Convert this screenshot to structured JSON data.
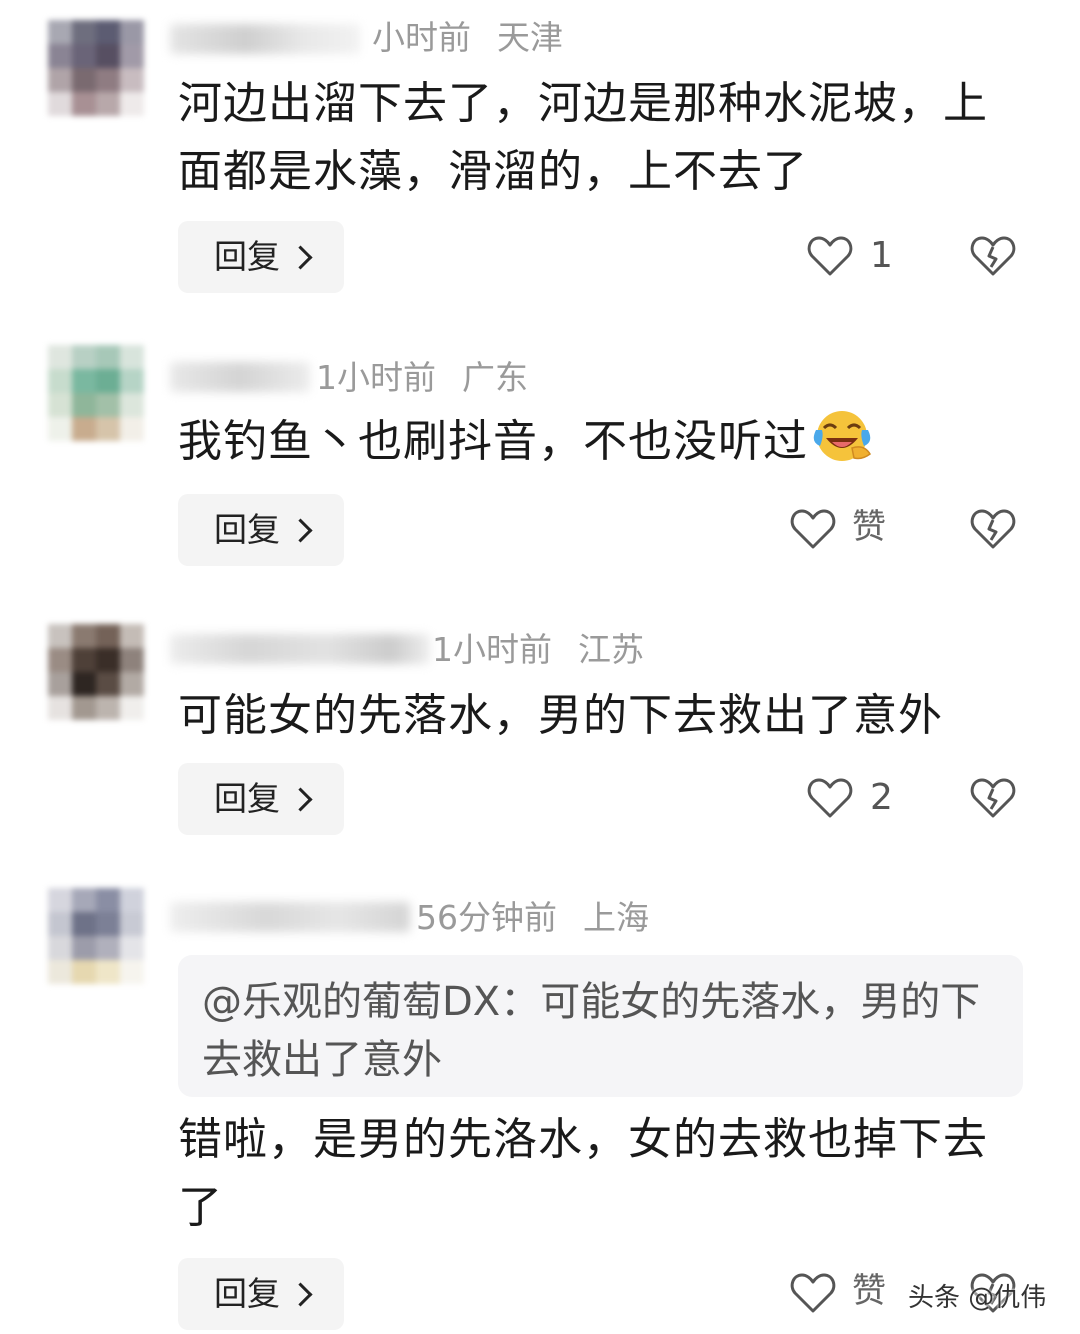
{
  "comments": [
    {
      "time": "小时前",
      "location": "天津",
      "text": "河边出溜下去了，河边是那种水泥坡，上面都是水藻，滑溜的，上不去了",
      "reply_label": "回复",
      "like_count": "1"
    },
    {
      "time": "1小时前",
      "location": "广东",
      "text": "我钓鱼丶也刷抖音，不也没听过",
      "emoji": "laughing-crying-emoji",
      "reply_label": "回复",
      "like_label": "赞"
    },
    {
      "time": "1小时前",
      "location": "江苏",
      "text": "可能女的先落水，男的下去救出了意外",
      "reply_label": "回复",
      "like_count": "2"
    },
    {
      "time": "56分钟前",
      "location": "上海",
      "quote": "@乐观的葡萄DX：可能女的先落水，男的下去救出了意外",
      "text": "错啦，是男的先洛水，女的去救也掉下去了",
      "reply_label": "回复",
      "like_label": "赞"
    }
  ],
  "watermark": "头条 @仇伟",
  "icons": {
    "like": "heart-outline-icon",
    "dislike": "broken-heart-icon",
    "reply_arrow": "chevron-right-icon"
  },
  "colors": {
    "text": "#1a1a1a",
    "meta": "#9a9a9a",
    "button_bg": "#f4f4f4",
    "quote_bg": "#f5f5f7"
  }
}
